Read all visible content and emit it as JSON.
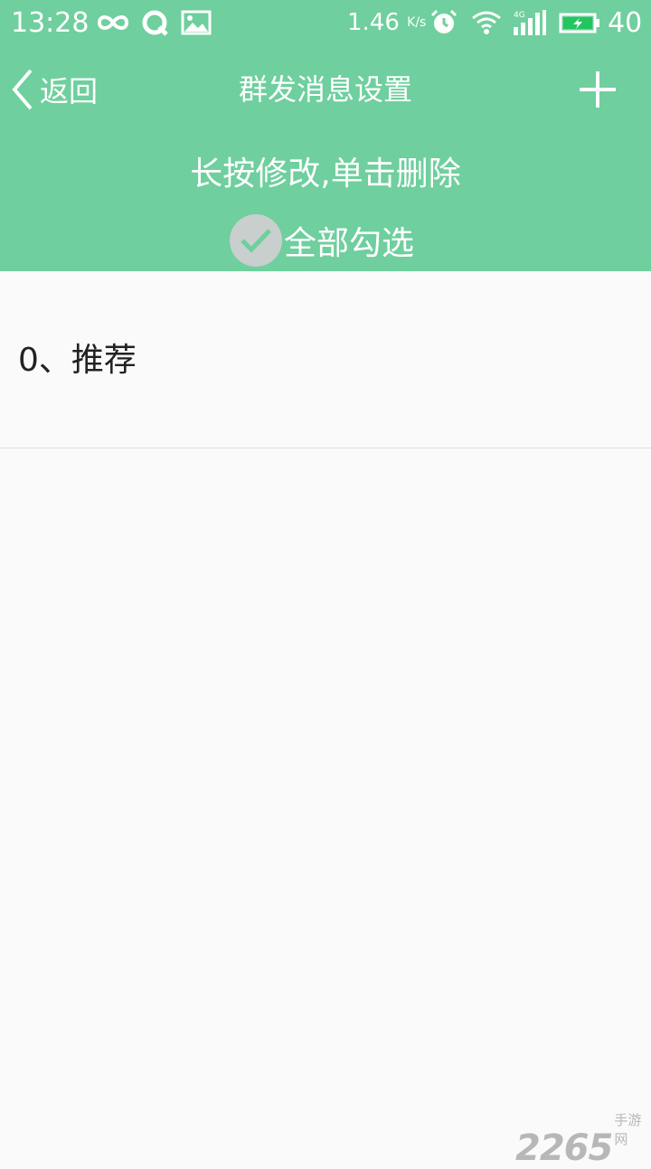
{
  "status_bar": {
    "time": "13:28",
    "speed": "1.46",
    "speed_unit": "K/s",
    "network": "4G",
    "battery": "40",
    "icons": [
      "infinity-icon",
      "q-app-icon",
      "gallery-icon",
      "alarm-icon",
      "wifi-icon",
      "signal-icon",
      "battery-charging-icon"
    ]
  },
  "nav": {
    "back_label": "返回",
    "title": "群发消息设置",
    "add_icon": "plus-icon"
  },
  "hint": "长按修改,单击删除",
  "select_all": {
    "label": "全部勾选",
    "icon": "check-icon"
  },
  "list": {
    "items": [
      {
        "label": "0、推荐"
      }
    ]
  },
  "watermark": {
    "number": "2265",
    "text": "手游网"
  },
  "colors": {
    "header": "#6fcf9e",
    "background": "#fafafa",
    "check_circle": "#c9cfcc",
    "check_mark": "#6fcf9e"
  }
}
